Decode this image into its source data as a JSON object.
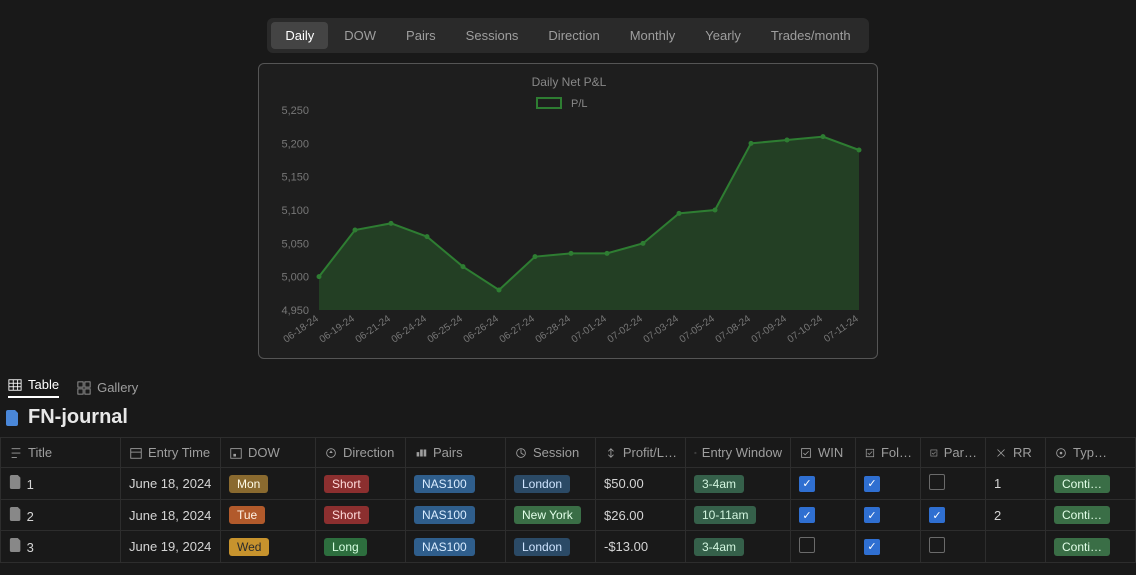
{
  "tabs": [
    "Daily",
    "DOW",
    "Pairs",
    "Sessions",
    "Direction",
    "Monthly",
    "Yearly",
    "Trades/month"
  ],
  "active_tab": 0,
  "chart_data": {
    "type": "line",
    "title": "Daily Net P&L",
    "legend": [
      "P/L"
    ],
    "ylabel": "",
    "xlabel": "",
    "ylim": [
      4950,
      5250
    ],
    "yticks": [
      4950,
      5000,
      5050,
      5100,
      5150,
      5200,
      5250
    ],
    "categories": [
      "06-18-24",
      "06-19-24",
      "06-21-24",
      "06-24-24",
      "06-25-24",
      "06-26-24",
      "06-27-24",
      "06-28-24",
      "07-01-24",
      "07-02-24",
      "07-03-24",
      "07-05-24",
      "07-08-24",
      "07-09-24",
      "07-10-24",
      "07-11-24"
    ],
    "series": [
      {
        "name": "P/L",
        "values": [
          5000,
          5070,
          5080,
          5060,
          5015,
          4980,
          5030,
          5035,
          5035,
          5050,
          5095,
          5100,
          5200,
          5205,
          5210,
          5190
        ]
      }
    ],
    "colors": {
      "line": "#2e7d32",
      "fill": "rgba(46,125,50,0.35)"
    }
  },
  "view_tabs": [
    "Table",
    "Gallery"
  ],
  "active_view": 0,
  "journal_title": "FN-journal",
  "columns": [
    "Title",
    "Entry Time",
    "DOW",
    "Direction",
    "Pairs",
    "Session",
    "Profit/L…",
    "Entry Window",
    "WIN",
    "Fol…",
    "Par…",
    "RR",
    "Typ…"
  ],
  "rows": [
    {
      "title": "1",
      "entry": "June 18, 2024",
      "dow": "Mon",
      "dir": "Short",
      "pair": "NAS100",
      "session": "London",
      "pl": "$50.00",
      "win": "3-4am",
      "winchk": true,
      "fol": true,
      "par": false,
      "rr": "1",
      "type": "Conti…"
    },
    {
      "title": "2",
      "entry": "June 18, 2024",
      "dow": "Tue",
      "dir": "Short",
      "pair": "NAS100",
      "session": "New York",
      "pl": "$26.00",
      "win": "10-11am",
      "winchk": true,
      "fol": true,
      "par": true,
      "rr": "2",
      "type": "Conti…"
    },
    {
      "title": "3",
      "entry": "June 19, 2024",
      "dow": "Wed",
      "dir": "Long",
      "pair": "NAS100",
      "session": "London",
      "pl": "-$13.00",
      "win": "3-4am",
      "winchk": false,
      "fol": true,
      "par": false,
      "rr": "",
      "type": "Conti…"
    }
  ]
}
